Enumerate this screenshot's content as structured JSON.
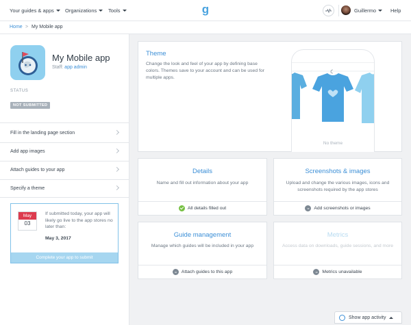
{
  "nav": {
    "guides_apps": "Your guides & apps",
    "organizations": "Organizations",
    "tools": "Tools",
    "logo_letter": "g",
    "user_name": "Guillermo",
    "help": "Help"
  },
  "breadcrumb": {
    "home": "Home",
    "separator": ">",
    "current": "My Mobile app"
  },
  "sidebar": {
    "app_name": "My Mobile app",
    "staff_prefix": "Staff:",
    "staff_role": "app admin",
    "status_label": "STATUS",
    "status_value": "NOT SUBMITTED",
    "tasks": [
      {
        "label": "Fill in the landing page section"
      },
      {
        "label": "Add app images"
      },
      {
        "label": "Attach guides to your app"
      },
      {
        "label": "Specify a theme"
      }
    ],
    "submit_card": {
      "cal_month": "May",
      "cal_day": "03",
      "text": "If submitted today, your app will likely go live to the app stores no later than:",
      "date": "May 3, 2017",
      "button": "Complete your app to submit"
    }
  },
  "theme": {
    "title": "Theme",
    "description": "Change the look and feel of your app by defining base colors. Themes save to your account and can be used for multiple apps.",
    "preview_label": "No theme"
  },
  "sections": {
    "details": {
      "title": "Details",
      "description": "Name and fill out information about your app",
      "status": "All details filled out"
    },
    "screenshots": {
      "title": "Screenshots & images",
      "description": "Upload and change the various images, icons and screenshots required by the app stores",
      "status": "Add screenshots or images"
    },
    "guides": {
      "title": "Guide management",
      "description": "Manage which guides will be included in your app",
      "status": "Attach guides to this app"
    },
    "metrics": {
      "title": "Metrics",
      "description": "Access data on downloads, guide sessions, and more",
      "status": "Metrics unavailable"
    }
  },
  "activity": {
    "label": "Show app activity"
  },
  "colors": {
    "accent": "#3a8ed6",
    "status_badge": "#a8b1ba",
    "success": "#76c043",
    "calendar": "#dd3b4e"
  }
}
